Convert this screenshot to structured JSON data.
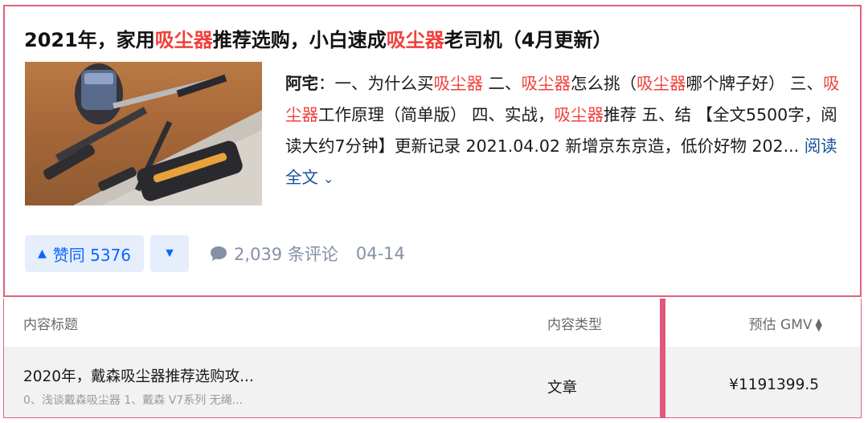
{
  "answer": {
    "title_parts": [
      {
        "text": "2021年，家用",
        "hl": false
      },
      {
        "text": "吸尘器",
        "hl": true
      },
      {
        "text": "推荐选购，小白速成",
        "hl": false
      },
      {
        "text": "吸尘器",
        "hl": true
      },
      {
        "text": "老司机（4月更新）",
        "hl": false
      }
    ],
    "author": "阿宅",
    "excerpt_parts": [
      {
        "text": "：一、为什么买",
        "hl": false
      },
      {
        "text": "吸尘器",
        "hl": true
      },
      {
        "text": " 二、",
        "hl": false
      },
      {
        "text": "吸尘器",
        "hl": true
      },
      {
        "text": "怎么挑（",
        "hl": false
      },
      {
        "text": "吸尘器",
        "hl": true
      },
      {
        "text": "哪个牌子好） 三、",
        "hl": false
      },
      {
        "text": "吸尘器",
        "hl": true
      },
      {
        "text": "工作原理（简单版） 四、实战，",
        "hl": false
      },
      {
        "text": "吸尘器",
        "hl": true
      },
      {
        "text": "推荐 五、结 【全文5500字，阅读大约7分钟】更新记录 2021.04.02 新增京东京造，低价好物 202...",
        "hl": false
      }
    ],
    "read_more": "阅读全文",
    "vote_up": "赞同 5376",
    "comments": "2,039 条评论",
    "date": "04-14",
    "colors": {
      "highlight": "#f1403c",
      "link": "#175199",
      "vote": "#0a66ff",
      "border": "#e0607e"
    },
    "icons": {
      "vote_up": "triangle-up-icon",
      "vote_down": "triangle-down-icon",
      "comment": "speech-bubble-icon",
      "read_more": "chevron-down-icon"
    }
  },
  "table": {
    "headers": {
      "title": "内容标题",
      "type": "内容类型",
      "gmv": "预估 GMV"
    },
    "rows": [
      {
        "title": "2020年，戴森吸尘器推荐选购攻...",
        "subtitle": "0、浅谈戴森吸尘器 1、戴森 V7系列 无绳...",
        "type": "文章",
        "gmv": "¥1191399.5"
      }
    ]
  }
}
